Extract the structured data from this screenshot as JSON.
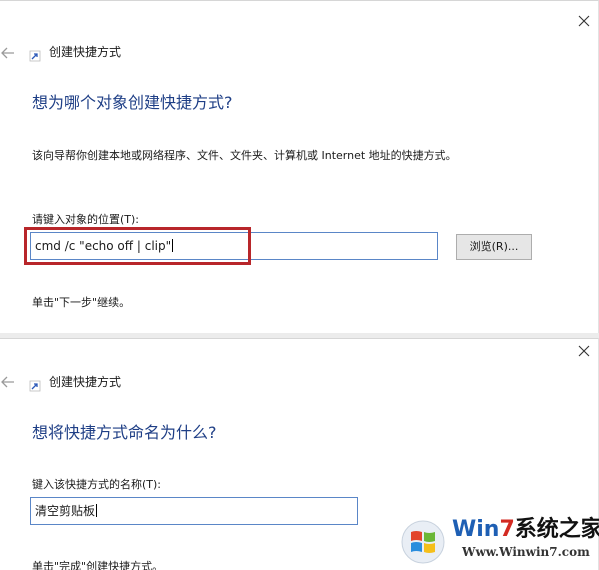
{
  "panel1": {
    "window_title": "创建快捷方式",
    "heading": "想为哪个对象创建快捷方式?",
    "description": "该向导帮你创建本地或网络程序、文件、文件夹、计算机或 Internet 地址的快捷方式。",
    "location_label": "请键入对象的位置(T):",
    "location_value": "cmd /c \"echo off | clip\"",
    "browse_label": "浏览(R)...",
    "next_hint": "单击\"下一步\"继续。"
  },
  "panel2": {
    "window_title": "创建快捷方式",
    "heading": "想将快捷方式命名为什么?",
    "name_label": "键入该快捷方式的名称(T):",
    "name_value": "清空剪贴板",
    "finish_hint": "单击\"完成\"创建快捷方式。"
  },
  "watermark": {
    "brand_prefix": "Win",
    "brand_seven": "7",
    "brand_suffix": "系统之家",
    "url": "Www.Winwin7.com"
  },
  "colors": {
    "heading": "#1f3f86",
    "input_border": "#5a86c7",
    "highlight": "#b8262a"
  }
}
